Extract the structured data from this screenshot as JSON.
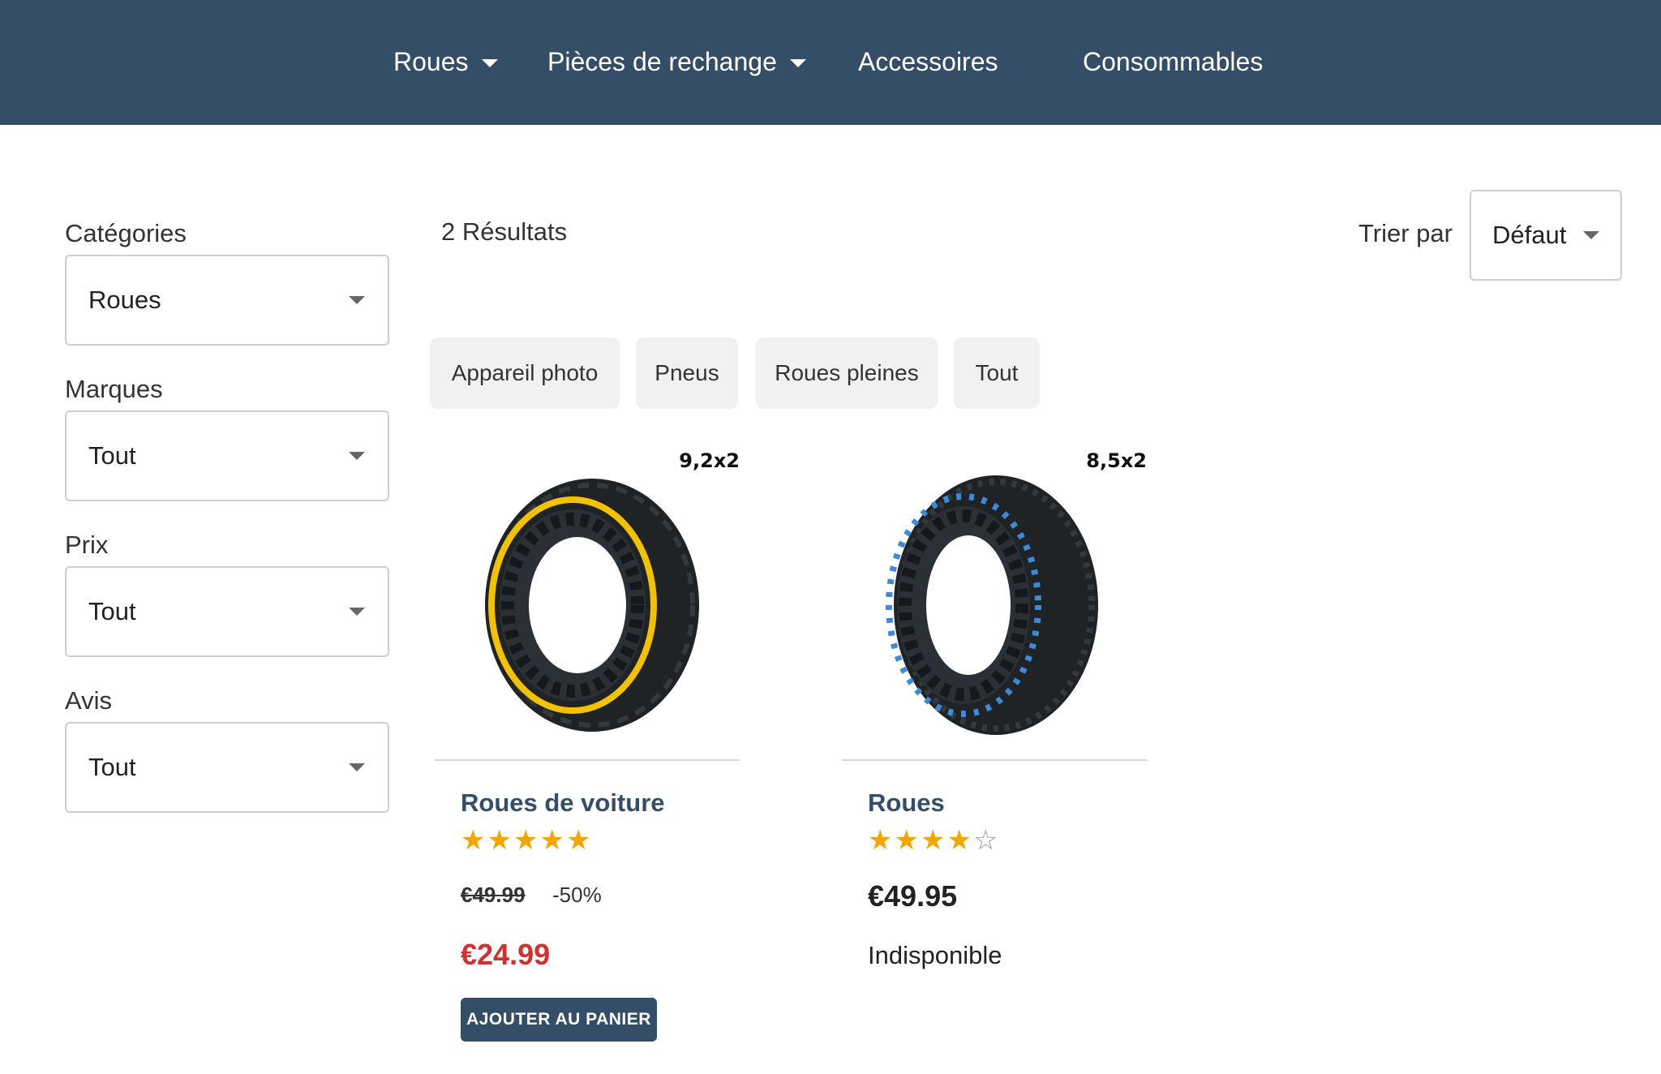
{
  "nav": {
    "items": [
      {
        "label": "Roues",
        "has_dropdown": true
      },
      {
        "label": "Pièces de rechange",
        "has_dropdown": true
      },
      {
        "label": "Accessoires",
        "has_dropdown": false
      },
      {
        "label": "Consommables",
        "has_dropdown": false
      }
    ]
  },
  "filters": {
    "categories": {
      "label": "Catégories",
      "value": "Roues"
    },
    "brands": {
      "label": "Marques",
      "value": "Tout"
    },
    "price": {
      "label": "Prix",
      "value": "Tout"
    },
    "reviews": {
      "label": "Avis",
      "value": "Tout"
    }
  },
  "results": {
    "count_text": "2 Résultats",
    "sort_label": "Trier par",
    "sort_value": "Défaut"
  },
  "chips": [
    "Appareil photo",
    "Pneus",
    "Roues pleines",
    "Tout"
  ],
  "products": [
    {
      "size_label": "9,2x2",
      "title": "Roues de voiture",
      "rating": 5,
      "rating_max": 5,
      "old_price": "€49.99",
      "discount": "-50%",
      "price": "€24.99",
      "button_label": "AJOUTER AU PANIER",
      "accent_color": "#f2c200"
    },
    {
      "size_label": "8,5x2",
      "title": "Roues",
      "rating": 4,
      "rating_max": 5,
      "price": "€49.95",
      "availability": "Indisponible",
      "accent_color": "#3c8ad8"
    }
  ],
  "colors": {
    "header_bg": "#344e68",
    "sale_price": "#d32f2f",
    "star": "#f5a500"
  }
}
